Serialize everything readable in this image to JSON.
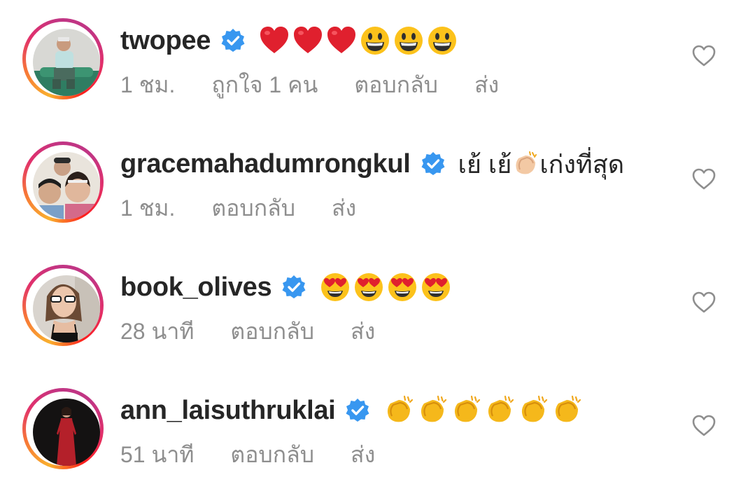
{
  "comments": [
    {
      "username": "twopee",
      "text": "",
      "emojis": [
        "heart",
        "heart",
        "heart",
        "grin",
        "grin",
        "grin"
      ],
      "time": "1 ชม.",
      "likes": "ถูกใจ 1 คน",
      "reply": "ตอบกลับ",
      "send": "ส่ง"
    },
    {
      "username": "gracemahadumrongkul",
      "text_before": "เย้ เย้",
      "text_after": "เก่งที่สุด",
      "time": "1 ชม.",
      "reply": "ตอบกลับ",
      "send": "ส่ง"
    },
    {
      "username": "book_olives",
      "emojis": [
        "heart-eyes",
        "heart-eyes",
        "heart-eyes",
        "heart-eyes"
      ],
      "time": "28 นาที",
      "reply": "ตอบกลับ",
      "send": "ส่ง"
    },
    {
      "username": "ann_laisuthruklai",
      "emojis": [
        "clap",
        "clap",
        "clap",
        "clap",
        "clap",
        "clap"
      ],
      "time": "51 นาที",
      "reply": "ตอบกลับ",
      "send": "ส่ง"
    }
  ],
  "colors": {
    "verified": "#3897f0",
    "text": "#262626",
    "meta": "#8e8e8e"
  }
}
